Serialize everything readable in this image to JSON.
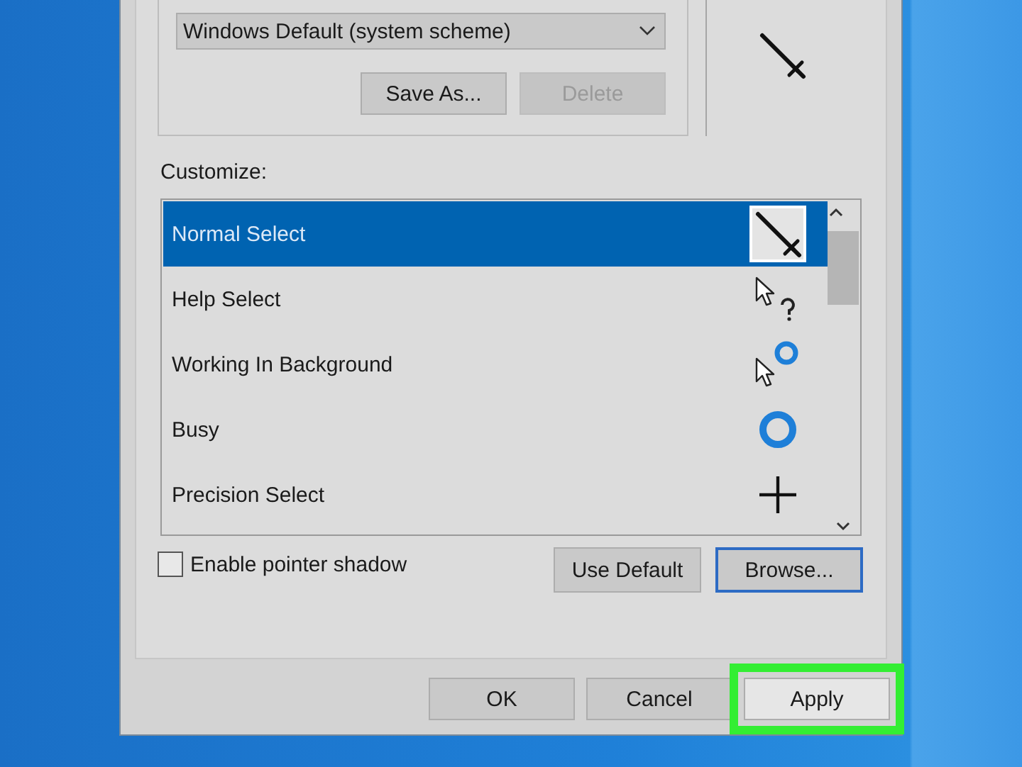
{
  "scheme": {
    "value": "Windows Default (system scheme)",
    "buttons": [
      {
        "label": "Save As...",
        "disabled": false
      },
      {
        "label": "Delete",
        "disabled": true
      }
    ]
  },
  "customize_label": "Customize:",
  "cursors": [
    {
      "name": "Normal Select",
      "kind": "normal",
      "selected": true
    },
    {
      "name": "Help Select",
      "kind": "help",
      "selected": false
    },
    {
      "name": "Working In Background",
      "kind": "working",
      "selected": false
    },
    {
      "name": "Busy",
      "kind": "busy",
      "selected": false
    },
    {
      "name": "Precision Select",
      "kind": "precision",
      "selected": false
    }
  ],
  "pointer_shadow": {
    "label": "Enable pointer shadow",
    "checked": false
  },
  "list_buttons": [
    {
      "label": "Use Default",
      "focused": false
    },
    {
      "label": "Browse...",
      "focused": true
    }
  ],
  "dialog_buttons": [
    {
      "label": "OK",
      "highlighted": false
    },
    {
      "label": "Cancel",
      "highlighted": false
    },
    {
      "label": "Apply",
      "highlighted": true
    }
  ]
}
